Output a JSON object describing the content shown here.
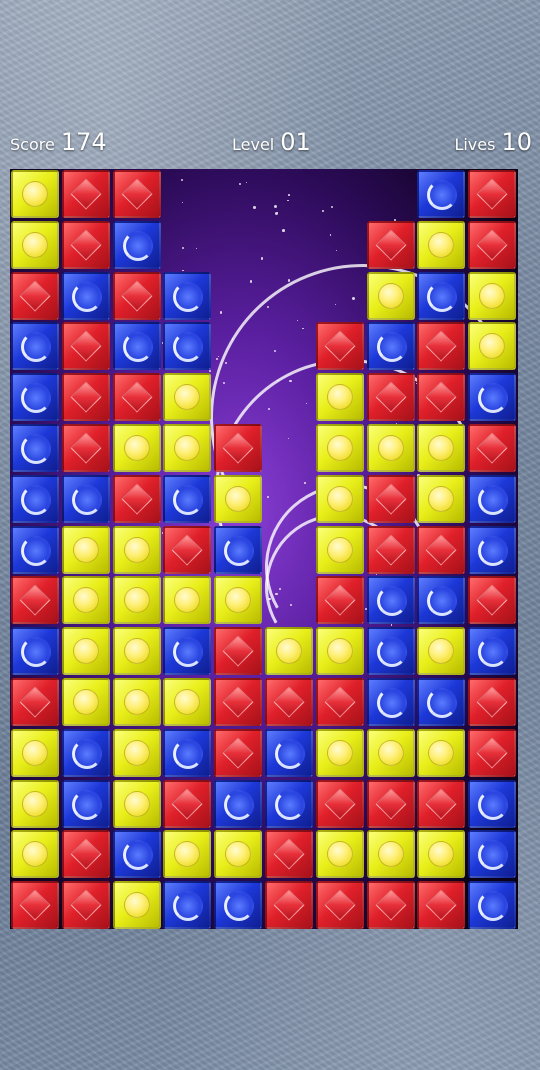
{
  "hud": {
    "score_label": "Score",
    "score_value": "174",
    "level_label": "Level",
    "level_value": "01",
    "lives_label": "Lives",
    "lives_value": "10"
  },
  "colors": {
    "R": "red",
    "Y": "yellow",
    "B": "blue"
  },
  "board": {
    "columns": 10,
    "rows": 15,
    "cells": [
      [
        "Y",
        "R",
        "R",
        "",
        "",
        "",
        "",
        "",
        "B",
        "R"
      ],
      [
        "Y",
        "R",
        "B",
        "",
        "",
        "",
        "",
        "R",
        "Y",
        "R"
      ],
      [
        "R",
        "B",
        "R",
        "B",
        "",
        "",
        "",
        "Y",
        "B",
        "Y"
      ],
      [
        "B",
        "R",
        "B",
        "B",
        "",
        "",
        "R",
        "B",
        "R",
        "Y"
      ],
      [
        "B",
        "R",
        "R",
        "Y",
        "",
        "",
        "Y",
        "R",
        "R",
        "B"
      ],
      [
        "B",
        "R",
        "Y",
        "Y",
        "R",
        "",
        "Y",
        "Y",
        "Y",
        "R"
      ],
      [
        "B",
        "B",
        "R",
        "B",
        "Y",
        "",
        "Y",
        "R",
        "Y",
        "B"
      ],
      [
        "B",
        "Y",
        "Y",
        "R",
        "B",
        "",
        "Y",
        "R",
        "R",
        "B"
      ],
      [
        "R",
        "Y",
        "Y",
        "Y",
        "Y",
        "",
        "R",
        "B",
        "B",
        "R"
      ],
      [
        "B",
        "Y",
        "Y",
        "B",
        "R",
        "Y",
        "Y",
        "B",
        "Y",
        "B"
      ],
      [
        "R",
        "Y",
        "Y",
        "Y",
        "R",
        "R",
        "R",
        "B",
        "B",
        "R"
      ],
      [
        "Y",
        "B",
        "Y",
        "B",
        "R",
        "B",
        "Y",
        "Y",
        "Y",
        "R"
      ],
      [
        "Y",
        "B",
        "Y",
        "R",
        "B",
        "B",
        "R",
        "R",
        "R",
        "B"
      ],
      [
        "Y",
        "R",
        "B",
        "Y",
        "Y",
        "R",
        "Y",
        "Y",
        "Y",
        "B"
      ],
      [
        "R",
        "R",
        "Y",
        "B",
        "B",
        "R",
        "R",
        "R",
        "R",
        "B"
      ]
    ]
  }
}
